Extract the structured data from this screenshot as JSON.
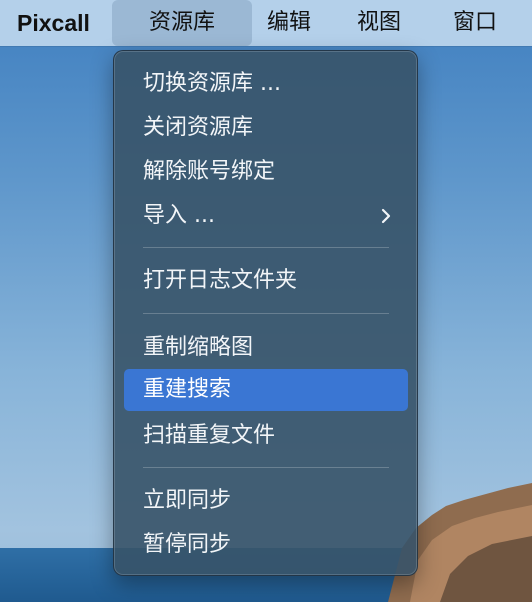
{
  "menubar": {
    "app_name": "Pixcall",
    "items": [
      "资源库",
      "编辑",
      "视图",
      "窗口"
    ],
    "active_item": "资源库"
  },
  "dropdown": {
    "groups": [
      {
        "items": [
          {
            "label": "切换资源库 ..."
          },
          {
            "label": "关闭资源库"
          },
          {
            "label": "解除账号绑定"
          },
          {
            "label": "导入 ...",
            "submenu": true,
            "icon": "chevron-right-icon"
          }
        ]
      },
      {
        "items": [
          {
            "label": "打开日志文件夹"
          }
        ]
      },
      {
        "items": [
          {
            "label": "重制缩略图"
          },
          {
            "label": "重建搜索",
            "highlighted": true
          },
          {
            "label": "扫描重复文件"
          }
        ]
      },
      {
        "items": [
          {
            "label": "立即同步"
          },
          {
            "label": "暂停同步"
          }
        ]
      }
    ]
  },
  "colors": {
    "highlight": "#3a76d3",
    "menu_text": "#f2f5f8",
    "menubar_bg": "#bed7ee"
  }
}
